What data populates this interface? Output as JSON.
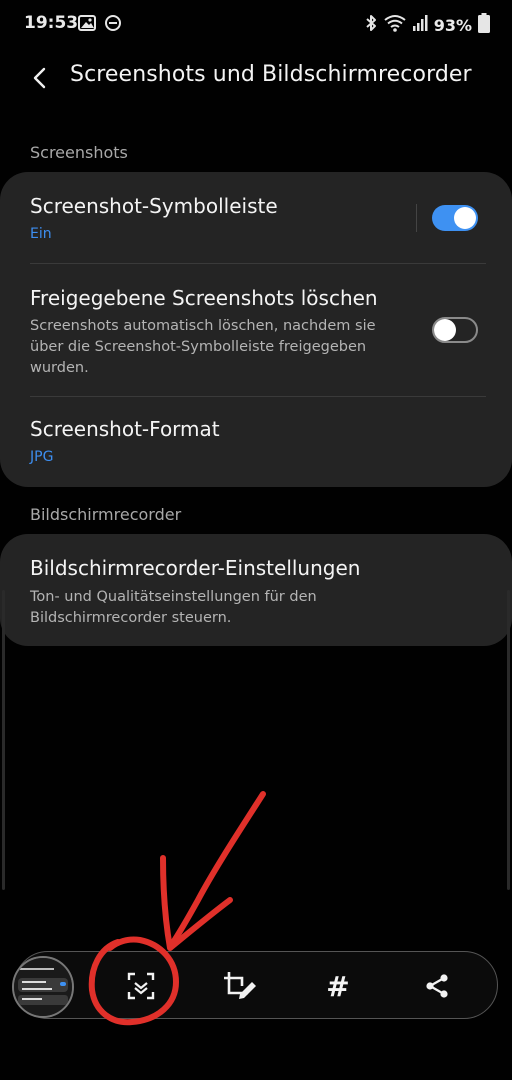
{
  "status_bar": {
    "time": "19:53",
    "battery_percent": "93%",
    "left_icons": [
      "image-icon",
      "do-not-disturb-icon"
    ],
    "right_icons": [
      "bluetooth-icon",
      "wifi-icon",
      "signal-icon",
      "battery-icon"
    ]
  },
  "header": {
    "title": "Screenshots und Bildschirmrecorder"
  },
  "sections": {
    "screenshots_label": "Screenshots",
    "recorder_label": "Bildschirmrecorder"
  },
  "items": {
    "toolbar": {
      "title": "Screenshot-Symbolleiste",
      "status": "Ein",
      "enabled": true
    },
    "delete_shared": {
      "title": "Freigegebene Screenshots löschen",
      "desc_line1": "Screenshots automatisch löschen, nachdem sie",
      "desc_line2": "über die Screenshot-Symbolleiste freigegeben",
      "desc_line3": "wurden.",
      "enabled": false
    },
    "format": {
      "title": "Screenshot-Format",
      "value": "JPG"
    },
    "recorder_settings": {
      "title": "Bildschirmrecorder-Einstellungen",
      "desc_line1": "Ton- und Qualitätseinstellungen für den",
      "desc_line2": "Bildschirmrecorder steuern."
    }
  },
  "bottom_toolbar": {
    "buttons": [
      "thumbnail-preview",
      "scroll-capture-icon",
      "crop-edit-icon",
      "hashtag-icon",
      "share-icon"
    ],
    "hashtag_glyph": "#"
  },
  "colors": {
    "background": "#010101",
    "card": "#242424",
    "accent_blue": "#3e91f2",
    "annotation_red": "#e0302a"
  }
}
